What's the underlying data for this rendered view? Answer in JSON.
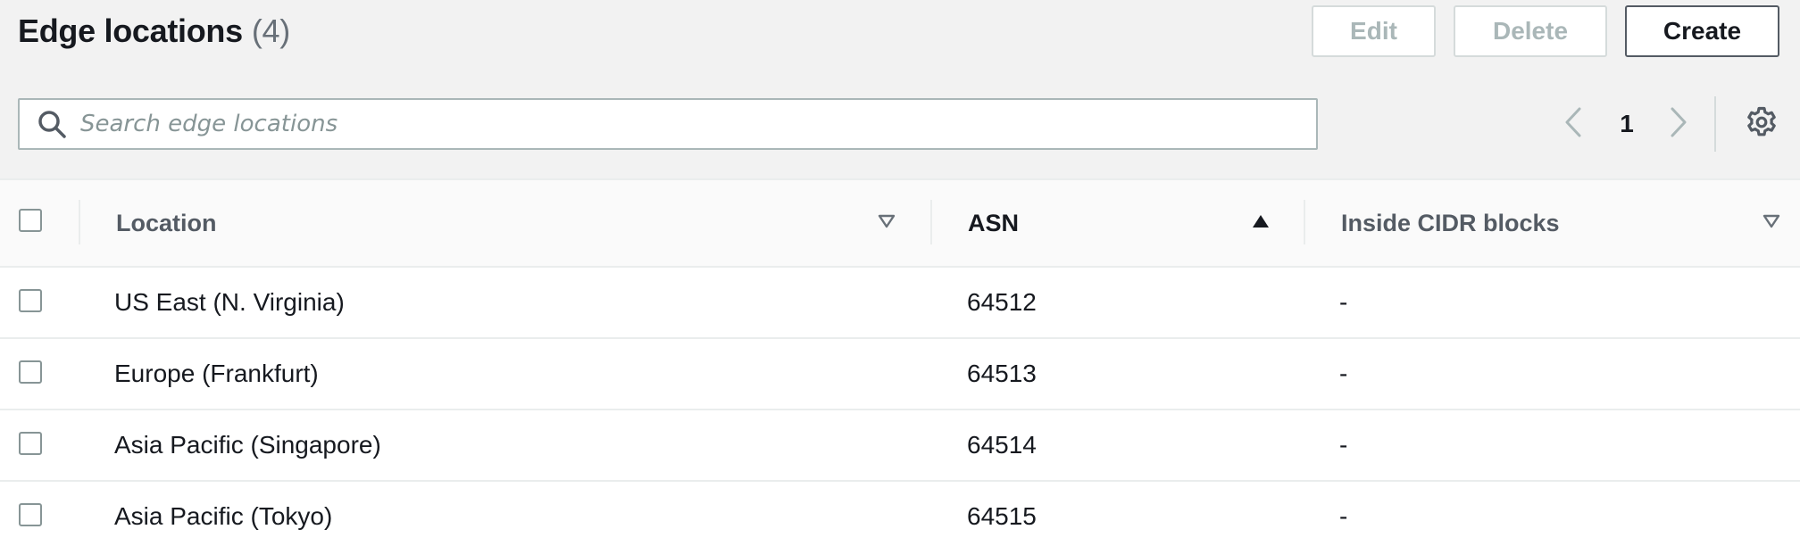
{
  "header": {
    "title": "Edge locations",
    "count": "(4)",
    "edit_label": "Edit",
    "delete_label": "Delete",
    "create_label": "Create"
  },
  "search": {
    "placeholder": "Search edge locations",
    "value": ""
  },
  "pagination": {
    "current_page": "1"
  },
  "table": {
    "columns": [
      {
        "label": "Location",
        "sort": "none"
      },
      {
        "label": "ASN",
        "sort": "ascending"
      },
      {
        "label": "Inside CIDR blocks",
        "sort": "none"
      }
    ],
    "rows": [
      {
        "location": "US East (N. Virginia)",
        "asn": "64512",
        "cidr": "-"
      },
      {
        "location": "Europe (Frankfurt)",
        "asn": "64513",
        "cidr": "-"
      },
      {
        "location": "Asia Pacific (Singapore)",
        "asn": "64514",
        "cidr": "-"
      },
      {
        "location": "Asia Pacific (Tokyo)",
        "asn": "64515",
        "cidr": "-"
      }
    ]
  },
  "icons": {
    "search": "search-icon",
    "prev": "chevron-left-icon",
    "next": "chevron-right-icon",
    "settings": "gear-icon",
    "sort_none": "caret-down-outline-icon",
    "sort_asc": "caret-up-filled-icon"
  },
  "colors": {
    "header_bg": "#f2f2f2",
    "text_primary": "#16191f",
    "text_secondary": "#545b64",
    "disabled": "#aab7b8",
    "border": "#eaeded"
  }
}
